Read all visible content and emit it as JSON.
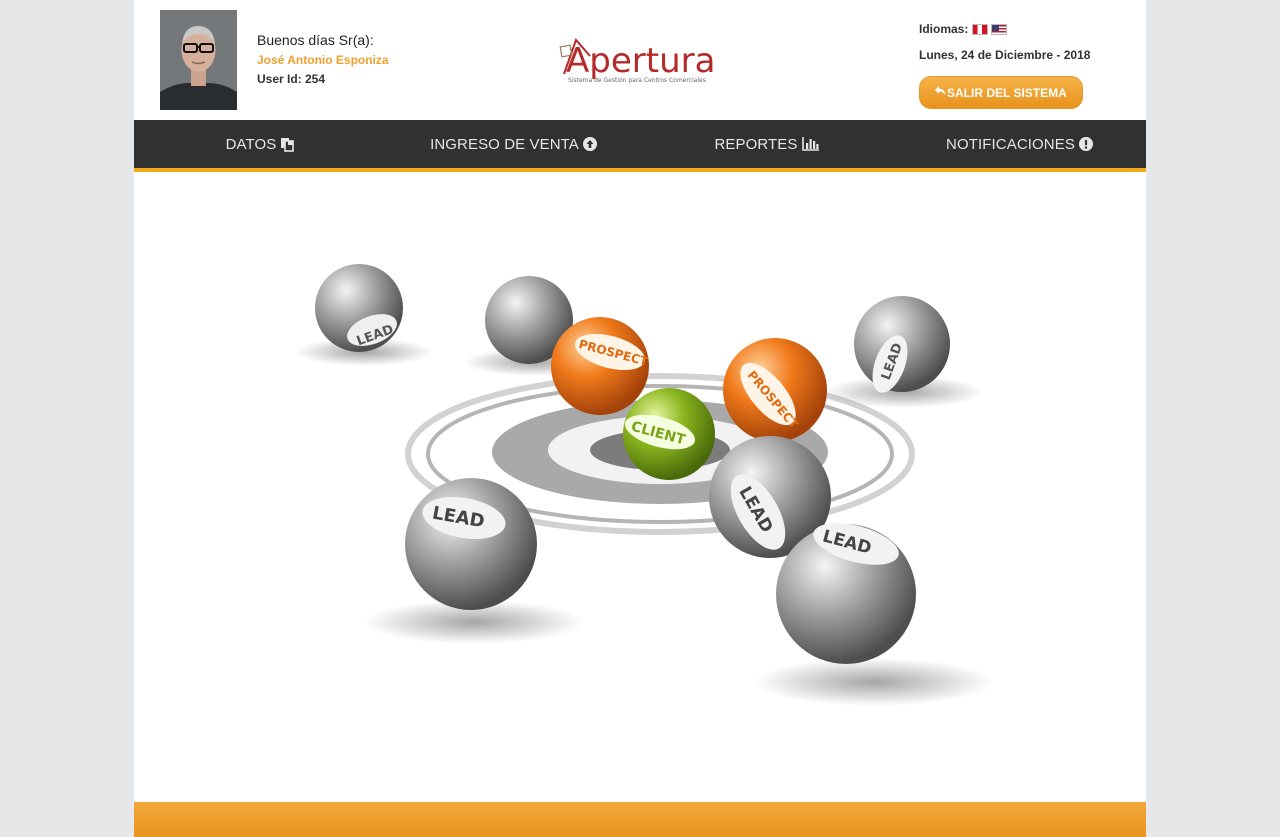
{
  "header": {
    "greeting": "Buenos días Sr(a):",
    "user_name": "José Antonio Esponiza",
    "user_id": "User Id: 254",
    "logo_text": "Apertura",
    "logo_tagline": "Sistema de Gestión para Centros Comerciales",
    "languages_label": "Idiomas:",
    "date": "Lunes, 24 de Diciembre - 2018",
    "logout_label": "SALIR DEL SISTEMA"
  },
  "nav": {
    "items": [
      {
        "label": "DATOS",
        "icon": "copy-icon"
      },
      {
        "label": "INGRESO DE VENTA",
        "icon": "arrow-circle-up-icon"
      },
      {
        "label": "REPORTES",
        "icon": "bar-chart-icon"
      },
      {
        "label": "NOTIFICACIONES",
        "icon": "exclamation-circle-icon"
      }
    ]
  },
  "hero": {
    "labels": [
      "LEAD",
      "LEAD",
      "PROSPECT",
      "PROSPECT",
      "CLIENT",
      "LEAD",
      "LEAD",
      "LEAD",
      "LEAD"
    ]
  },
  "colors": {
    "accent": "#f2a91c",
    "nav_bg": "#313131",
    "username": "#f0a030",
    "logo_red": "#b52a2a",
    "page_bg": "#e6e7e9"
  }
}
